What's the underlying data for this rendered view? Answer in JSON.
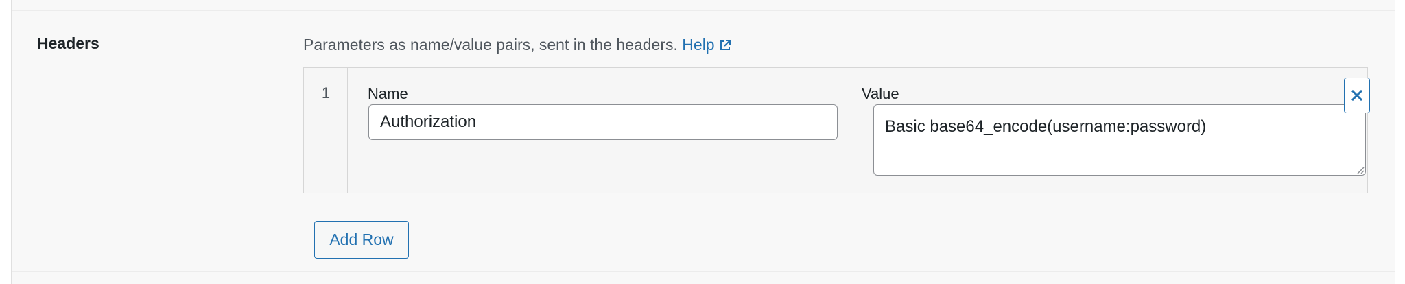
{
  "section": {
    "label": "Headers",
    "description": "Parameters as name/value pairs, sent in the headers.",
    "help_link": "Help",
    "help_icon": "external-link-icon"
  },
  "repeater": {
    "rows": [
      {
        "number": "1",
        "name_label": "Name",
        "name_value": "Authorization",
        "value_label": "Value",
        "value_value": "Basic base64_encode(username:password)",
        "remove_icon": "close-icon"
      }
    ],
    "add_row_label": "Add Row"
  },
  "colors": {
    "accent": "#2271b1",
    "text": "#1d2327",
    "muted_text": "#50575e",
    "panel_bg": "#f8f8f8",
    "border": "#d6d6d6",
    "input_border": "#8c8f94"
  }
}
